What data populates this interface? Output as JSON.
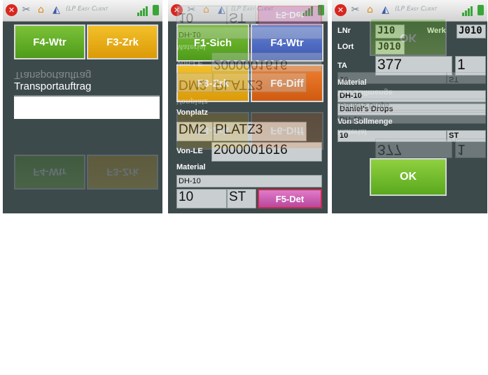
{
  "titlebar": {
    "app_title": "(LP Easy Client"
  },
  "screen1": {
    "btn_f4": "F4-Wtr",
    "btn_f3": "F3-Zrk",
    "label_transport": "Transportauftrag",
    "transport_value": ""
  },
  "screen2": {
    "btn_f1": "F1-Sich",
    "btn_f4": "F4-Wtr",
    "btn_f3": "F3-Zrk",
    "btn_f6": "F6-Diff",
    "label_vonplatz": "Vonplatz",
    "vonplatz_1": "DM2",
    "vonplatz_2": "PLATZ3",
    "label_vonle": "Von-LE",
    "vonle_value": "2000001616",
    "label_material": "Material",
    "material_value": "DH-10",
    "qty_value": "10",
    "unit_value": "ST",
    "btn_f5": "F5-Det"
  },
  "screen3": {
    "label_lnr": "LNr",
    "lnr_value": "J10",
    "label_werk": "Werk",
    "werk_value": "J010",
    "label_lort": "LOrt",
    "lort_value": "J010",
    "label_ta": "TA",
    "ta_value": "377",
    "ta_pos": "1",
    "label_material": "Material",
    "material_value": "DH-10",
    "material_desc": "Daniel's Drops",
    "label_sollmenge": "Von Sollmenge",
    "soll_value": "10",
    "soll_unit": "ST",
    "btn_ok": "OK"
  }
}
